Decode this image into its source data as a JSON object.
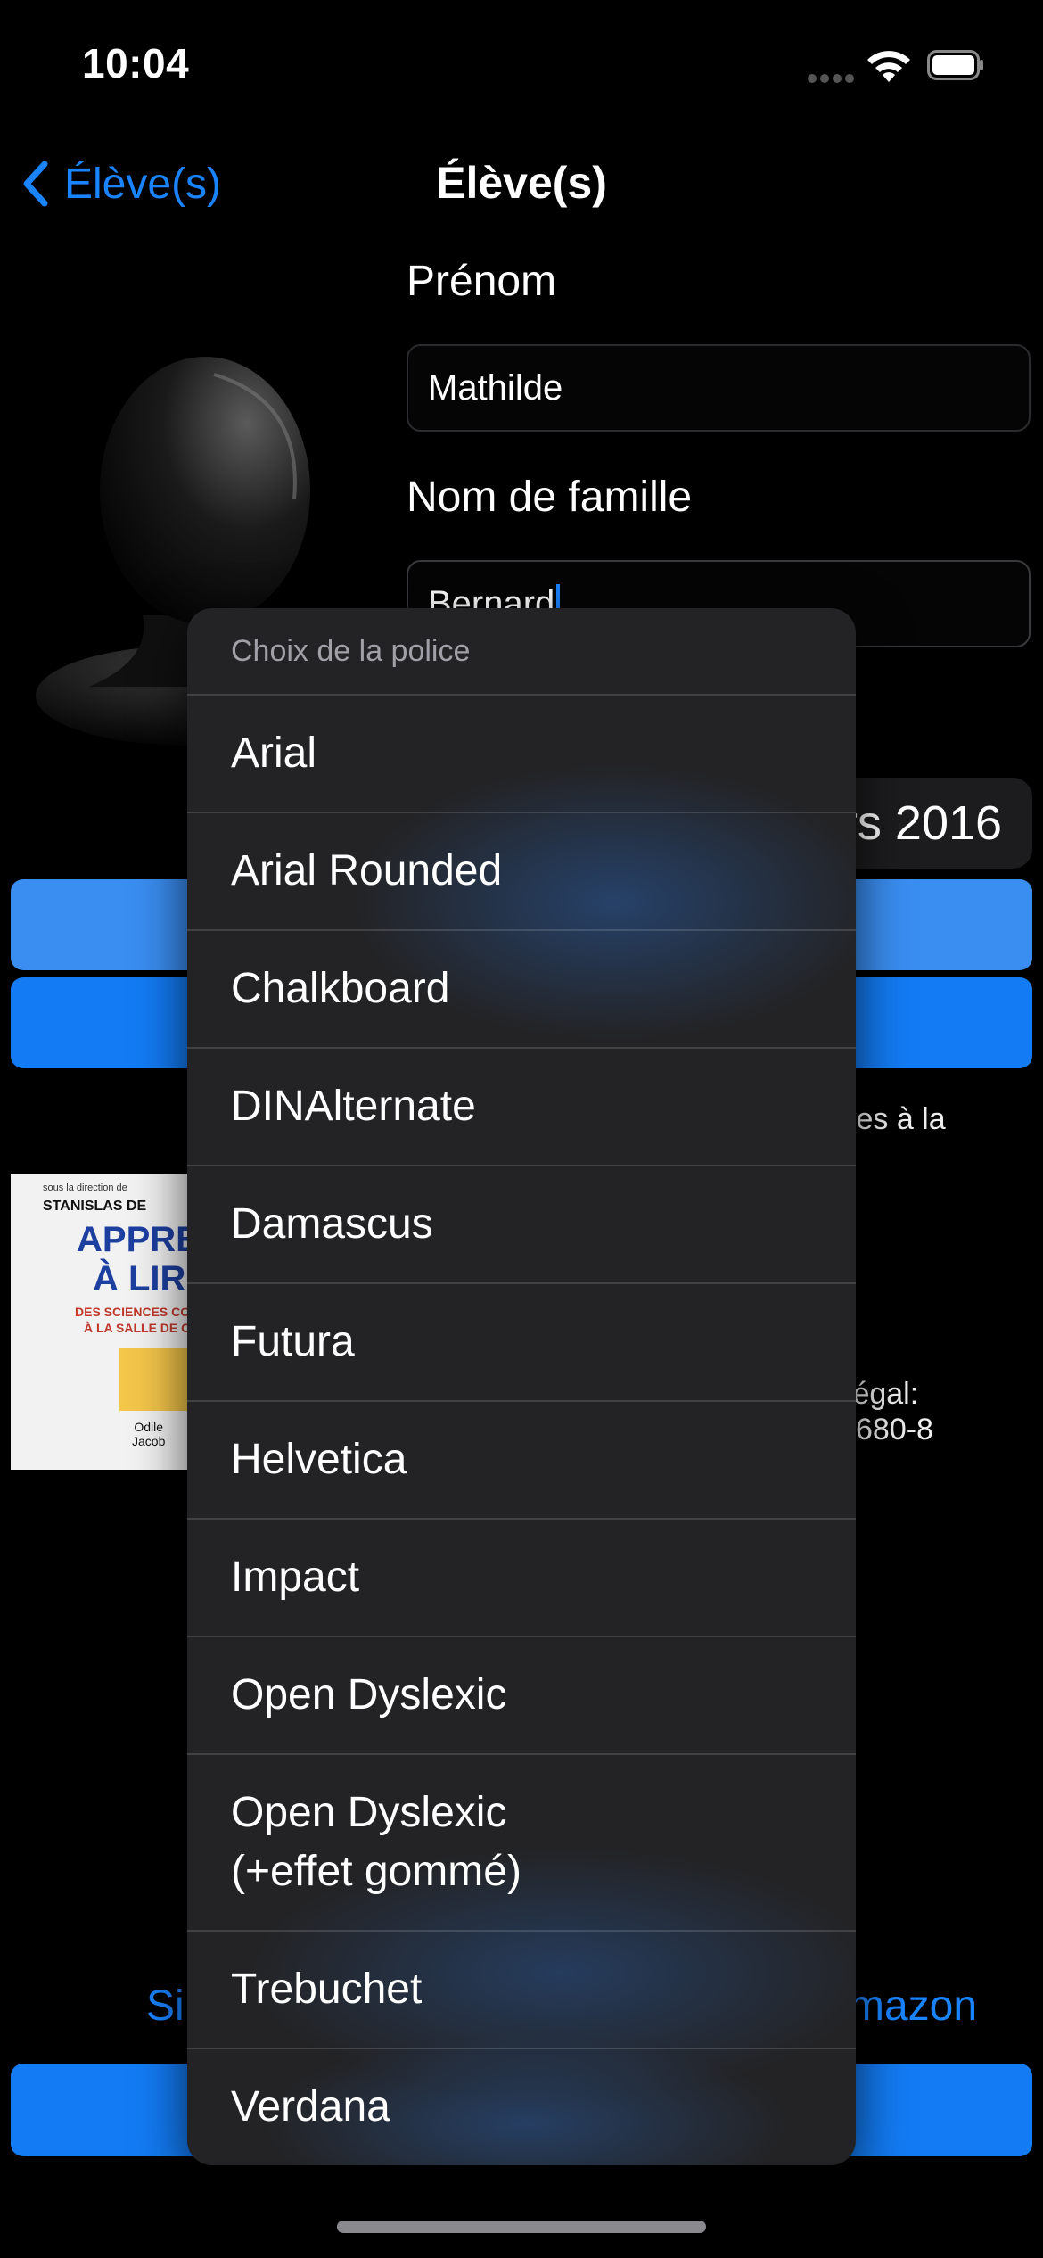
{
  "status_bar": {
    "time": "10:04"
  },
  "nav": {
    "back_label": "Élève(s)",
    "title": "Élève(s)"
  },
  "form": {
    "first_name_label": "Prénom",
    "first_name_value": "Mathilde",
    "last_name_label": "Nom de famille",
    "last_name_value": "Bernard"
  },
  "background": {
    "date_partial": "rs 2016",
    "description_partial": "nitives à la",
    "legal_partial_1": "t légal:",
    "legal_partial_2": "680-8",
    "link_left_partial": "Si",
    "link_right_partial": "mazon",
    "book": {
      "subtitle": "sous la direction de",
      "author_partial": "STANISLAS DE",
      "title_line1": "APPREN",
      "title_line2": "À LIR",
      "desc_line1": "DES SCIENCES COG",
      "desc_line2": "À LA SALLE DE C",
      "publisher_line1": "Odile",
      "publisher_line2": "Jacob"
    }
  },
  "font_menu": {
    "header": "Choix de la police",
    "items": [
      {
        "label": "Arial"
      },
      {
        "label": "Arial Rounded"
      },
      {
        "label": "Chalkboard"
      },
      {
        "label": "DINAlternate"
      },
      {
        "label": "Damascus"
      },
      {
        "label": "Futura"
      },
      {
        "label": "Helvetica"
      },
      {
        "label": "Impact"
      },
      {
        "label": "Open Dyslexic"
      },
      {
        "label": "Open Dyslexic\n(+effet gommé)"
      },
      {
        "label": "Trebuchet"
      },
      {
        "label": "Verdana"
      }
    ]
  },
  "colors": {
    "accent": "#1a84ff",
    "background": "#000000",
    "menu_bg": "#232325"
  }
}
